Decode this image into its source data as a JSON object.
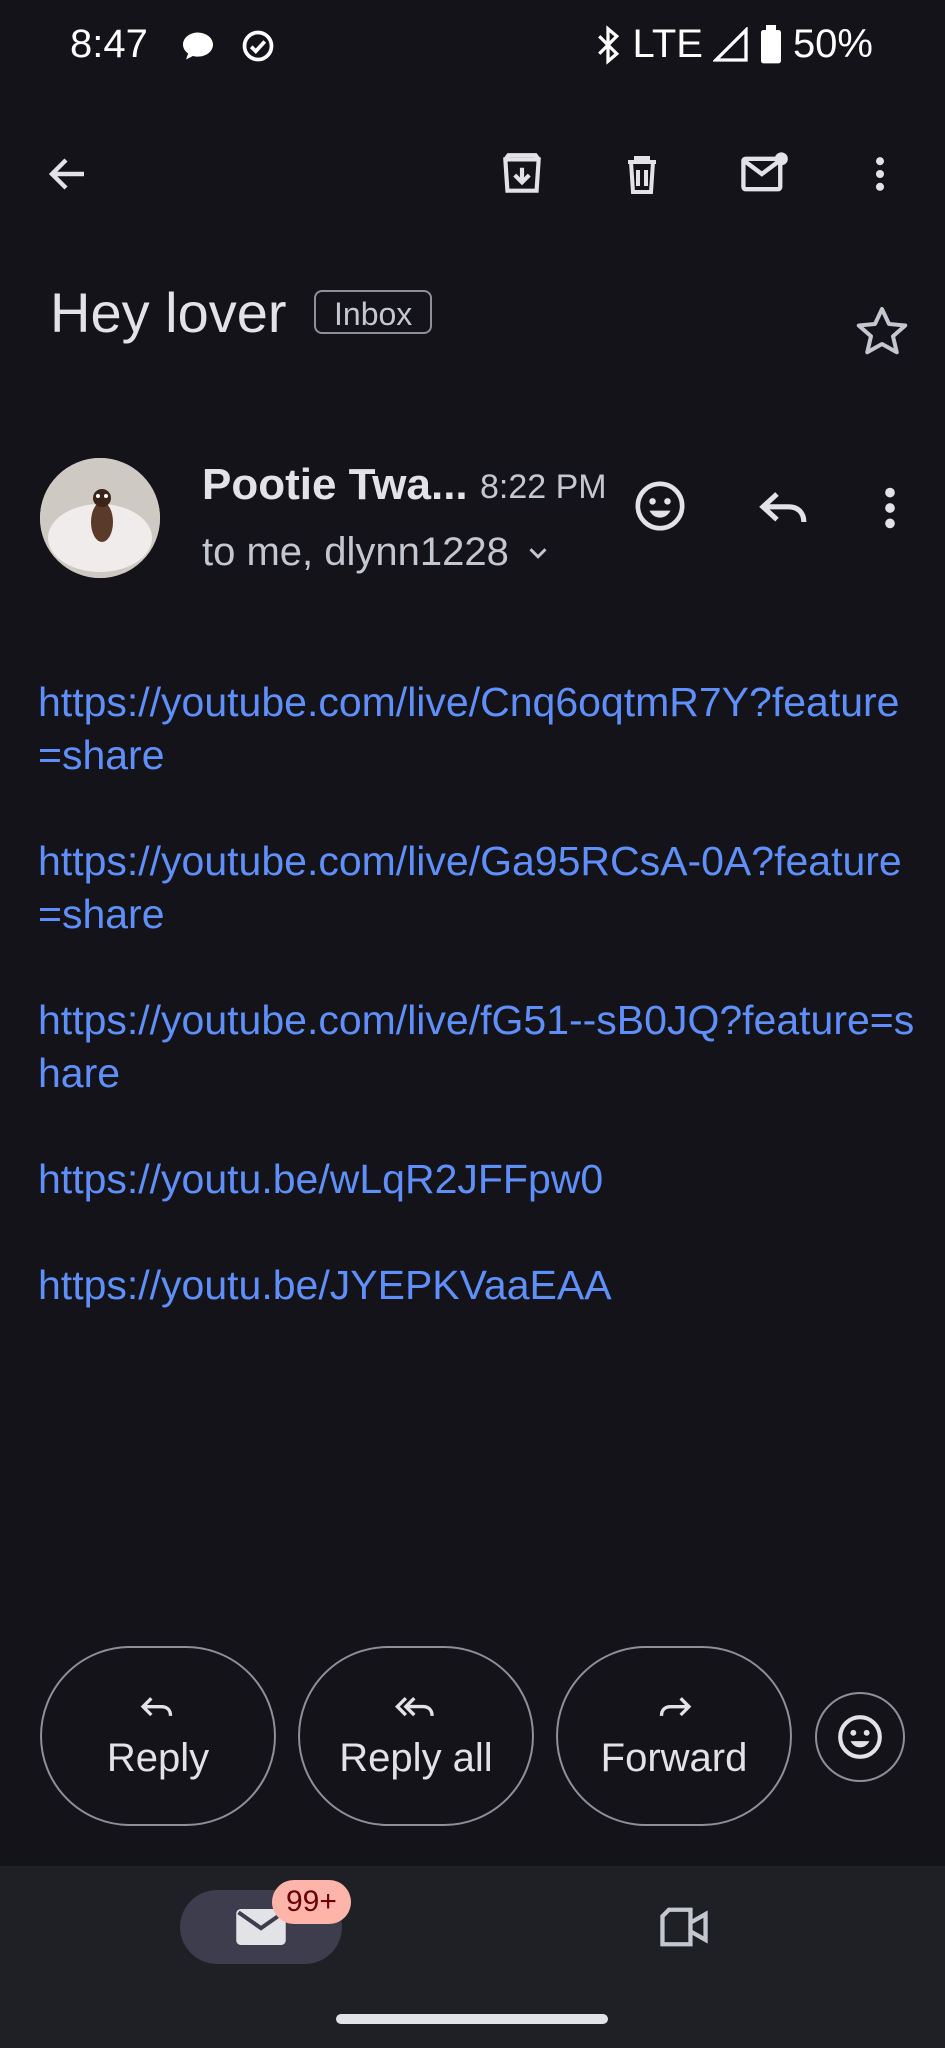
{
  "status_bar": {
    "time": "8:47",
    "network": "LTE",
    "battery": "50%",
    "icons": [
      "chat-bubble-icon",
      "check-circle-icon",
      "bluetooth-icon",
      "signal-icon",
      "battery-icon"
    ]
  },
  "top_bar": {
    "icons": [
      "back-arrow-icon",
      "archive-icon",
      "delete-icon",
      "mark-unread-icon",
      "more-vert-icon"
    ]
  },
  "email": {
    "subject": "Hey lover",
    "label": "Inbox",
    "sender": "Pootie Twa...",
    "time": "8:22 PM",
    "recipients": "to me, dlynn1228",
    "links": [
      "https://youtube.com/live/Cnq6oqtmR7Y?feature=share",
      "https://youtube.com/live/Ga95RCsA-0A?feature=share",
      "https://youtube.com/live/fG51--sB0JQ?feature=share",
      "https://youtu.be/wLqR2JFFpw0",
      "https://youtu.be/JYEPKVaaEAA"
    ]
  },
  "actions": {
    "reply": "Reply",
    "reply_all": "Reply all",
    "forward": "Forward"
  },
  "bottom_nav": {
    "mail_badge": "99+"
  },
  "colors": {
    "background": "#131319",
    "link": "#5f8ffb",
    "badge": "#ffb4a9"
  }
}
